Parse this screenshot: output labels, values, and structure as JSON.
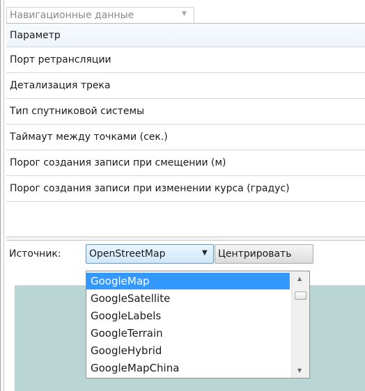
{
  "group": {
    "label": "Навигационные данные"
  },
  "grid": {
    "header": "Параметр",
    "rows": [
      "Порт ретрансляции",
      "Детализация трека",
      "Тип спутниковой системы",
      "Таймаут между точками (сек.)",
      "Порог создания записи при смещении (м)",
      "Порог создания записи при изменении курса (градус)"
    ]
  },
  "toolbar": {
    "source_label": "Источник:",
    "source_value": "OpenStreetMap",
    "center_label": "Центрировать"
  },
  "source_options": {
    "items": [
      "GoogleMap",
      "GoogleSatellite",
      "GoogleLabels",
      "GoogleTerrain",
      "GoogleHybrid",
      "GoogleMapChina"
    ],
    "selected": "GoogleMap"
  },
  "colors": {
    "selection": "#3399ff",
    "map_background": "#b9d6d4"
  }
}
